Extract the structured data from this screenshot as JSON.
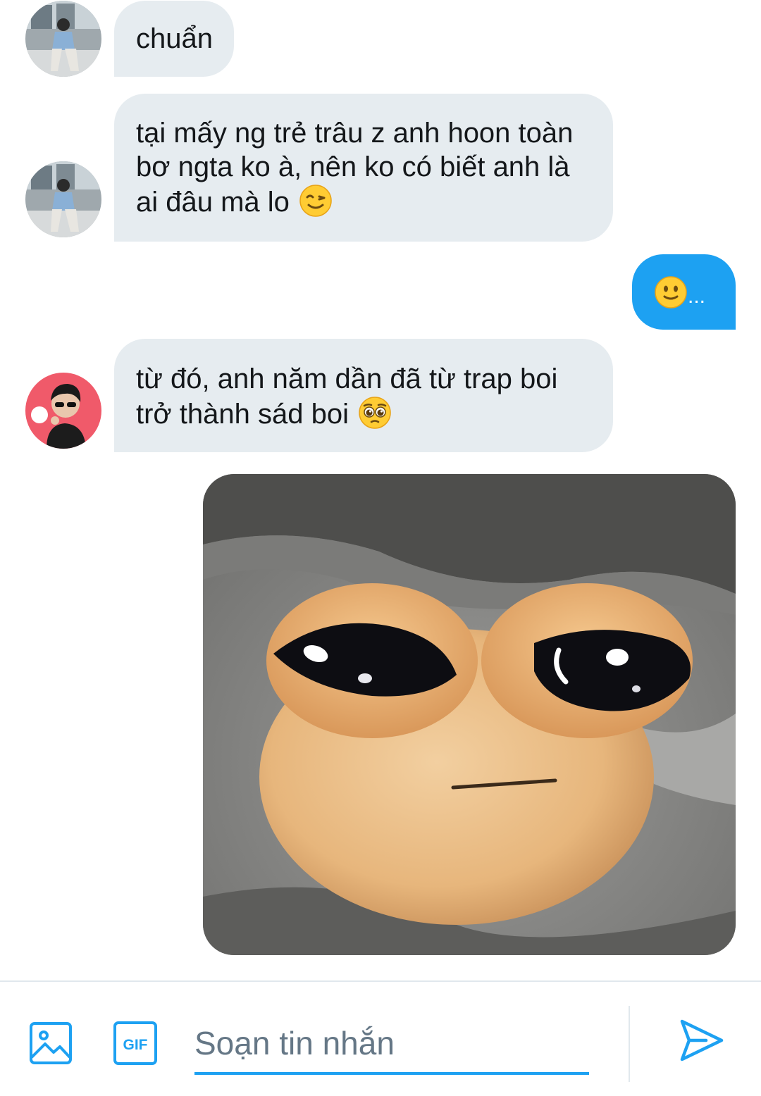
{
  "thread": {
    "messages": [
      {
        "from": "other",
        "avatar": "avatar-man-sitting",
        "text": "chuẩn"
      },
      {
        "from": "other",
        "avatar": "avatar-man-sitting",
        "lines": [
          "tại mấy ng trẻ trâu z anh hoon toàn",
          "bơ ngta ko à, nên ko có biết anh là",
          "ai đâu mà lo"
        ],
        "emoji": "winking-face-icon"
      },
      {
        "from": "me",
        "emoji": "slightly-smiling-face-icon",
        "text": "..."
      },
      {
        "from": "other",
        "avatar": "avatar-man-sunglasses",
        "lines": [
          "từ đó, anh năm dần đã từ trap boi",
          "trở thành sád boi"
        ],
        "emoji": "pleading-face-icon"
      },
      {
        "from": "me",
        "type": "image",
        "image": "sad-plush-frog-photo"
      }
    ]
  },
  "composer": {
    "placeholder": "Soạn tin nhắn",
    "value": "",
    "gif_label": "GIF",
    "icons": [
      "image-icon",
      "gif-icon",
      "send-icon"
    ]
  },
  "colors": {
    "accent": "#1da1f2",
    "incoming_bubble": "#e6ecf0",
    "text": "#14171a",
    "placeholder": "#657786"
  }
}
